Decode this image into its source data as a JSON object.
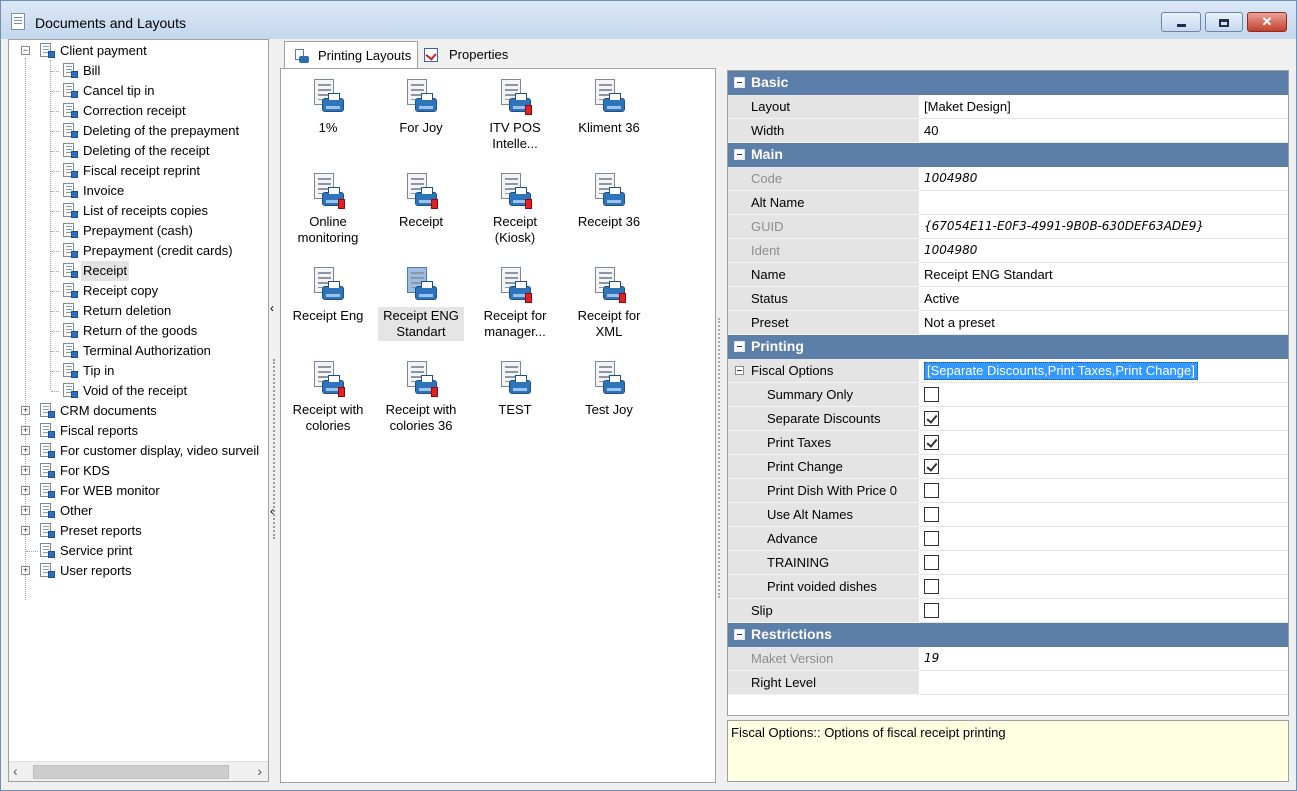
{
  "window": {
    "title": "Documents and Layouts"
  },
  "tree": {
    "root": "Client payment",
    "children": [
      "Bill",
      "Cancel tip in",
      "Correction receipt",
      "Deleting of the prepayment",
      "Deleting of the receipt",
      "Fiscal receipt reprint",
      "Invoice",
      "List of receipts copies",
      "Prepayment (cash)",
      "Prepayment (credit cards)",
      "Receipt",
      "Receipt copy",
      "Return deletion",
      "Return of the goods",
      "Terminal Authorization",
      "Tip in",
      "Void of the receipt"
    ],
    "groups": [
      "CRM documents",
      "Fiscal reports",
      "For customer display, video surveil",
      "For KDS",
      "For WEB monitor",
      "Other",
      "Preset reports",
      "Service print",
      "User reports"
    ]
  },
  "tabs": [
    {
      "label": "Printing Layouts",
      "icon": "printer-icon"
    },
    {
      "label": "Properties",
      "icon": "properties-icon"
    }
  ],
  "layouts": [
    {
      "line1": "1%",
      "line2": ""
    },
    {
      "line1": "For Joy",
      "line2": ""
    },
    {
      "line1": "ITV POS",
      "line2": "Intelle..."
    },
    {
      "line1": "Kliment 36",
      "line2": ""
    },
    {
      "line1": "Online",
      "line2": "monitoring"
    },
    {
      "line1": "Receipt",
      "line2": ""
    },
    {
      "line1": "Receipt",
      "line2": "(Kiosk)"
    },
    {
      "line1": "Receipt 36",
      "line2": ""
    },
    {
      "line1": "Receipt Eng",
      "line2": ""
    },
    {
      "line1": "Receipt ENG",
      "line2": "Standart"
    },
    {
      "line1": "Receipt for",
      "line2": "manager..."
    },
    {
      "line1": "Receipt for",
      "line2": "XML"
    },
    {
      "line1": "Receipt with",
      "line2": "colories"
    },
    {
      "line1": "Receipt with",
      "line2": "colories 36"
    },
    {
      "line1": "TEST",
      "line2": ""
    },
    {
      "line1": "Test Joy",
      "line2": ""
    }
  ],
  "properties": {
    "basic": {
      "category": "Basic",
      "layout_label": "Layout",
      "layout_value": "[Maket Design]",
      "width_label": "Width",
      "width_value": "40"
    },
    "main": {
      "category": "Main",
      "code_label": "Code",
      "code_value": "1004980",
      "altname_label": "Alt Name",
      "altname_value": "",
      "guid_label": "GUID",
      "guid_value": "{67054E11-E0F3-4991-9B0B-630DEF63ADE9}",
      "ident_label": "Ident",
      "ident_value": "1004980",
      "name_label": "Name",
      "name_value": "Receipt ENG Standart",
      "status_label": "Status",
      "status_value": "Active",
      "preset_label": "Preset",
      "preset_value": "Not a preset"
    },
    "printing": {
      "category": "Printing",
      "fiscal_label": "Fiscal Options",
      "fiscal_value": "[Separate Discounts,Print Taxes,Print Change]",
      "summary_only": "Summary Only",
      "separate_discounts": "Separate Discounts",
      "print_taxes": "Print Taxes",
      "print_change": "Print Change",
      "print_dish_zero": "Print Dish With Price 0",
      "use_alt_names": "Use Alt Names",
      "advance": "Advance",
      "training": "TRAINING",
      "print_voided": "Print voided dishes",
      "slip": "Slip"
    },
    "restrictions": {
      "category": "Restrictions",
      "maket_version_label": "Maket Version",
      "maket_version_value": "19",
      "right_level_label": "Right Level",
      "right_level_value": ""
    }
  },
  "description": "Fiscal Options:: Options of fiscal receipt printing"
}
